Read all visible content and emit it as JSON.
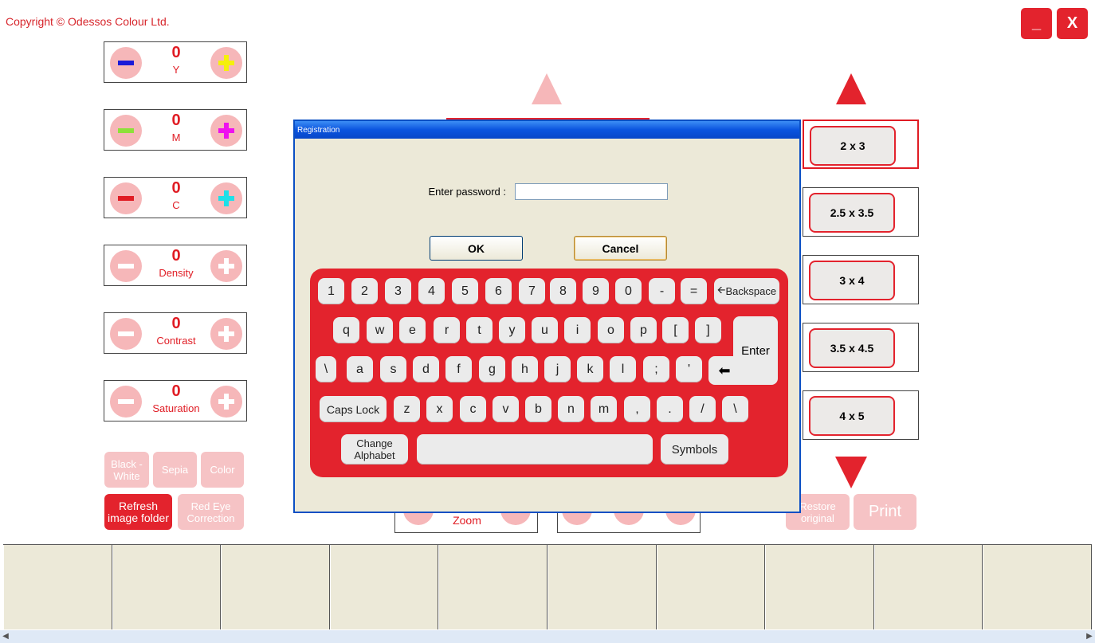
{
  "header": {
    "copyright": "Copyright © Odessos Colour Ltd."
  },
  "window_controls": {
    "minimize": "_",
    "close": "X"
  },
  "adjustments": [
    {
      "value": "0",
      "label": "Y"
    },
    {
      "value": "0",
      "label": "M"
    },
    {
      "value": "0",
      "label": "C"
    },
    {
      "value": "0",
      "label": "Density"
    },
    {
      "value": "0",
      "label": "Contrast"
    },
    {
      "value": "0",
      "label": "Saturation"
    }
  ],
  "effect_buttons": {
    "black_white": "Black - White",
    "sepia": "Sepia",
    "color": "Color",
    "refresh": "Refresh image folder",
    "red_eye": "Red Eye Correction"
  },
  "zoom": {
    "label": "Zoom"
  },
  "sizes": [
    "2 x 3",
    "2.5 x 3.5",
    "3 x 4",
    "3.5 x 4.5",
    "4 x 5"
  ],
  "bottom_actions": {
    "restore": "Restore original",
    "print": "Print"
  },
  "dialog": {
    "title": "Registration",
    "password_label": "Enter password :",
    "password_value": "",
    "ok": "OK",
    "cancel": "Cancel"
  },
  "keyboard": {
    "row1": [
      "1",
      "2",
      "3",
      "4",
      "5",
      "6",
      "7",
      "8",
      "9",
      "0",
      "-",
      "="
    ],
    "backspace": "Backspace",
    "row2": [
      "q",
      "w",
      "e",
      "r",
      "t",
      "y",
      "u",
      "i",
      "o",
      "p",
      "[",
      "]"
    ],
    "enter": "Enter",
    "row3": [
      "\\",
      "a",
      "s",
      "d",
      "f",
      "g",
      "h",
      "j",
      "k",
      "l",
      ";",
      "'"
    ],
    "caps_lock": "Caps Lock",
    "row4": [
      "z",
      "x",
      "c",
      "v",
      "b",
      "n",
      "m",
      ",",
      ".",
      "/",
      "\\"
    ],
    "change_alphabet": "Change Alphabet",
    "symbols": "Symbols"
  },
  "colors": {
    "accent": "#e3232d",
    "pale_accent": "#f6b7b9",
    "dialog_bg": "#ece9d8",
    "title_blue": "#0a54df"
  }
}
